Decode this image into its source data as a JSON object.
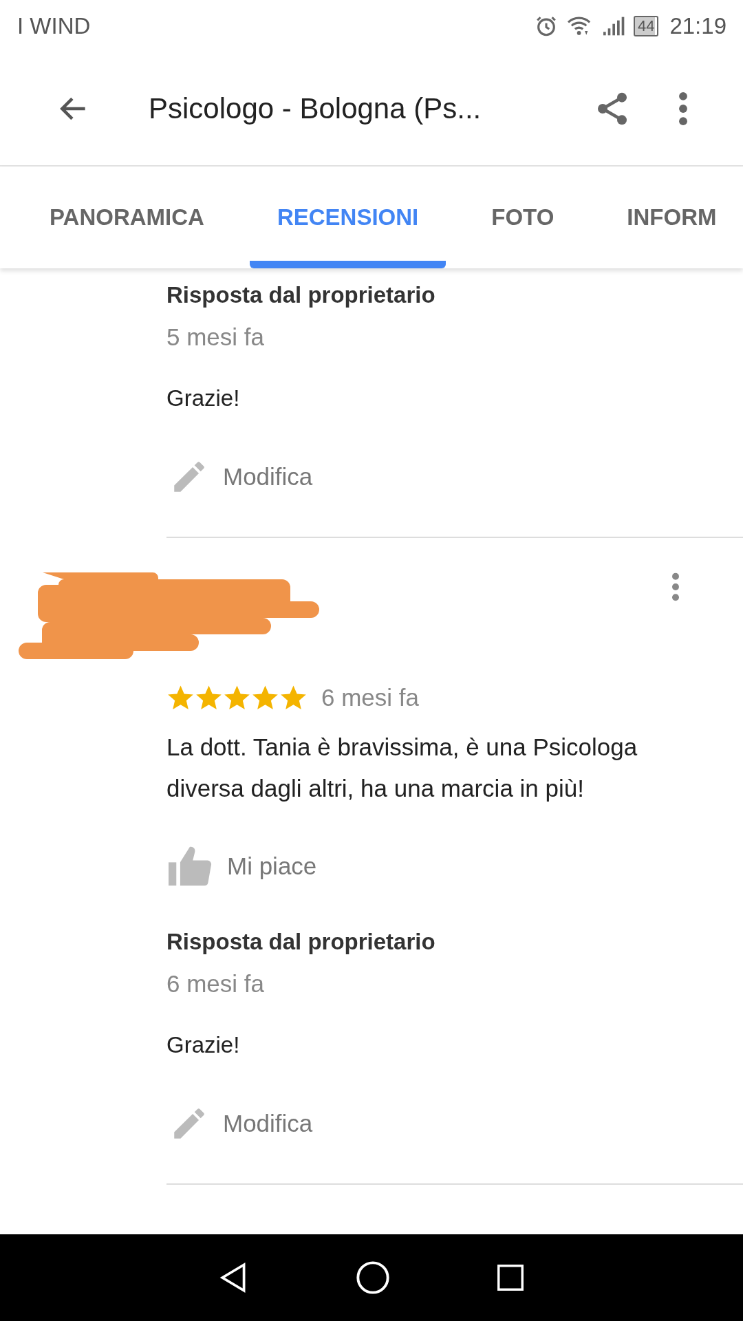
{
  "status_bar": {
    "carrier": "I WIND",
    "battery": "44",
    "time": "21:19"
  },
  "app_bar": {
    "title": "Psicologo - Bologna (Ps..."
  },
  "tabs": [
    {
      "label": "PANORAMICA",
      "selected": false
    },
    {
      "label": "RECENSIONI",
      "selected": true
    },
    {
      "label": "FOTO",
      "selected": false
    },
    {
      "label": "INFORM",
      "selected": false
    }
  ],
  "reviews": [
    {
      "owner_reply": {
        "heading": "Risposta dal proprietario",
        "time": "5 mesi fa",
        "text": "Grazie!",
        "edit_label": "Modifica"
      }
    },
    {
      "author_redacted": true,
      "stars": 5,
      "time": "6 mesi fa",
      "text": "La dott. Tania è bravissima, è una Psicologa diversa dagli altri, ha una marcia in più!",
      "like_label": "Mi piace",
      "owner_reply": {
        "heading": "Risposta dal proprietario",
        "time": "6 mesi fa",
        "text": "Grazie!",
        "edit_label": "Modifica"
      }
    }
  ]
}
